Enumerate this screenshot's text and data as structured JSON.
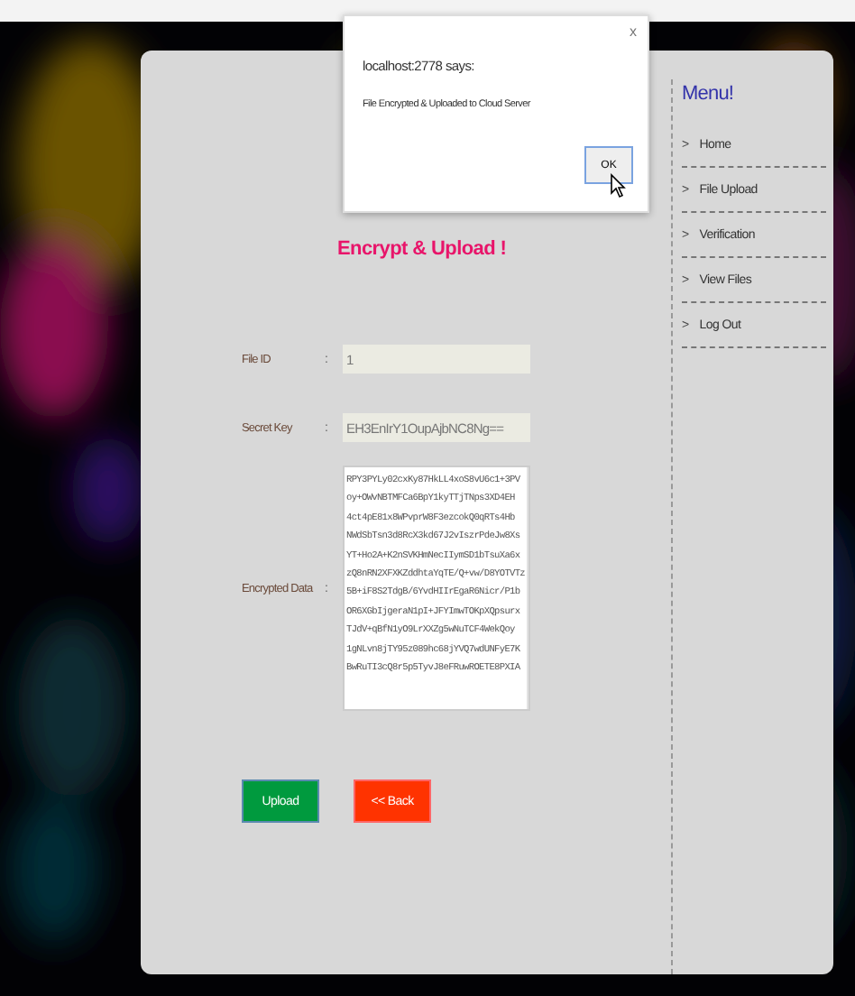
{
  "alert": {
    "title": "localhost:2778 says:",
    "message": "File Encrypted & Uploaded to Cloud Server",
    "close": "x",
    "button": "OK"
  },
  "heading": "Encrypt & Upload !",
  "fields": [
    {
      "label": "File ID",
      "separator": ":",
      "value": "1"
    },
    {
      "label": "Secret Key",
      "separator": ":",
      "value": "EH3EnIrY1OupAjbNC8Ng=="
    }
  ],
  "encrypted": {
    "label": "Encrypted Data",
    "separator": ":",
    "lines": [
      "RPY3PYLy02cxKy87HkLL4xoS8vU6c1+3PV",
      "oy+OWvNBTMFCa6BpY1kyTTjTNps3XD4EH",
      "4ct4pE81x8WPvprW8F3ezcokQ0qRTs4Hb",
      "NWdSbTsn3d8RcX3kd67J2vIszrPdeJw8Xs",
      "YT+Ho2A+K2nSVKHmNecIIymSD1bTsuXa6x",
      "zQ8nRN2XFXKZddhtaYqTE/Q+vw/D8YOTVTz",
      "5B+iF8S2TdgB/6YvdHIIrEgaR6Nicr/P1b",
      "OR6XGbIjgeraN1pI+JFYImwTOKpXQpsurx",
      "TJdV+qBfN1yO9LrXXZg5wNuTCF4WekQoy",
      "1gNLvn8jTY95z089hc68jYVQ7wdUNFyE7K",
      "BwRuTI3cQ8r5p5TyvJ8eFRuwROETE8PXIA"
    ]
  },
  "buttons": [
    {
      "kind": "primary",
      "label": "Upload"
    },
    {
      "kind": "danger",
      "label": "<< Back"
    }
  ],
  "menu": {
    "title": "Menu!",
    "items": [
      {
        "marker": ">",
        "label": "Home"
      },
      {
        "marker": ">",
        "label": "File Upload"
      },
      {
        "marker": ">",
        "label": "Verification"
      },
      {
        "marker": ">",
        "label": "View Files"
      },
      {
        "marker": ">",
        "label": "Log Out"
      }
    ]
  }
}
